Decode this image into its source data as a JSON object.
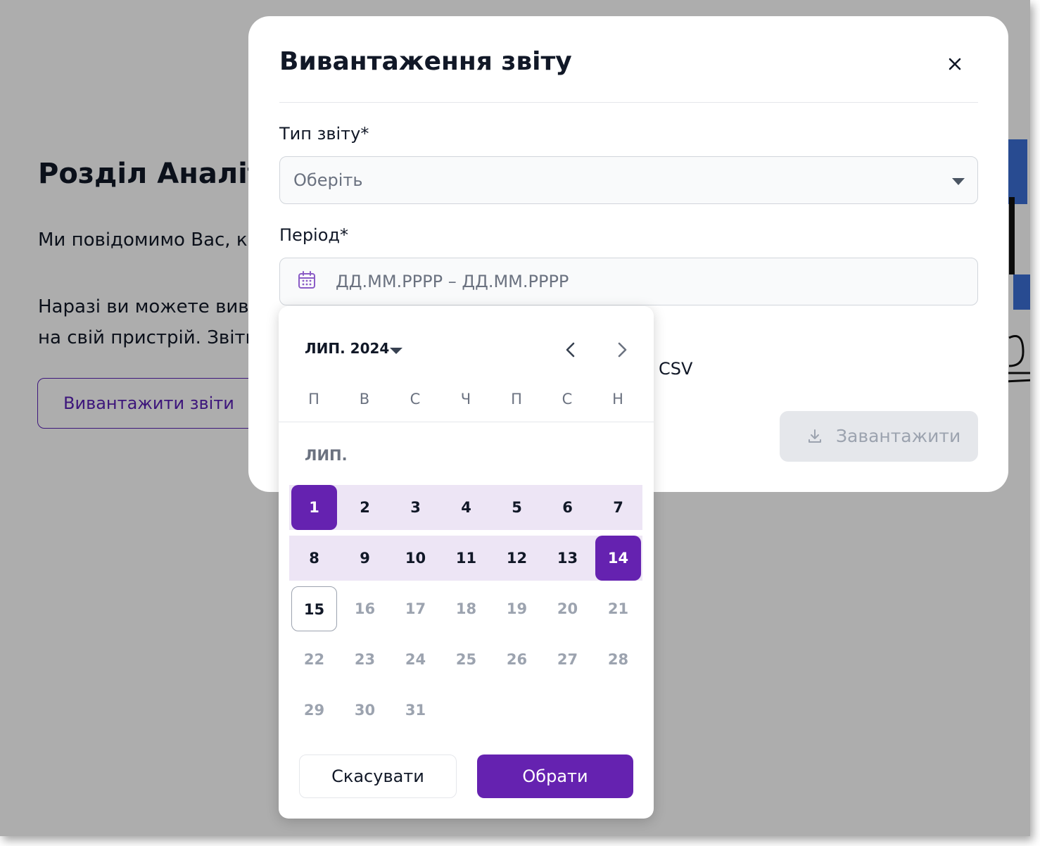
{
  "page": {
    "title": "Розділ Аналітики",
    "paragraph1": "Ми повідомимо Вас, коли",
    "paragraph2_line1": "Наразі ви можете вивантажити",
    "paragraph2_line2": "на свій пристрій. Звіти",
    "export_button": "Вивантажити звіти"
  },
  "modal": {
    "title": "Вивантаження звіту",
    "report_type_label": "Тип звіту*",
    "report_type_placeholder": "Оберіть",
    "period_label": "Період*",
    "period_placeholder": "ДД.ММ.РРРР – ДД.ММ.РРРР",
    "format_option": "CSV",
    "download_button": "Завантажити"
  },
  "calendar": {
    "header_month": "ЛИП. 2024",
    "weekdays": [
      "П",
      "В",
      "С",
      "Ч",
      "П",
      "С",
      "Н"
    ],
    "month_label": "ЛИП.",
    "days": [
      1,
      2,
      3,
      4,
      5,
      6,
      7,
      8,
      9,
      10,
      11,
      12,
      13,
      14,
      15,
      16,
      17,
      18,
      19,
      20,
      21,
      22,
      23,
      24,
      25,
      26,
      27,
      28,
      29,
      30,
      31
    ],
    "range_start": 1,
    "range_end": 14,
    "today": 15,
    "cancel_button": "Скасувати",
    "choose_button": "Обрати"
  },
  "colors": {
    "accent": "#6522b0",
    "range_fill": "#ede5f5",
    "overlay": "#adadad",
    "disabled_button": "#e5e7eb"
  },
  "icons": {
    "close": "close-icon",
    "select_caret": "chevron-down-icon",
    "calendar": "calendar-icon",
    "prev": "chevron-left-icon",
    "next": "chevron-right-icon",
    "download": "download-icon"
  }
}
